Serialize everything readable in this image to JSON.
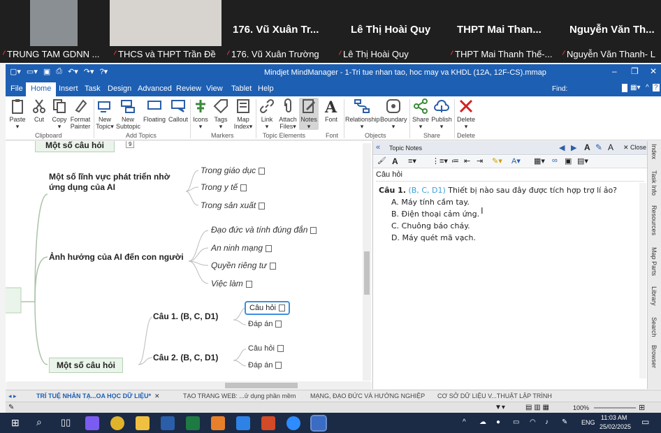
{
  "participants": [
    {
      "tile_name": "",
      "label": "TRUNG TAM GDNN ..."
    },
    {
      "tile_name": "",
      "label": "THCS và THPT Trần Đề"
    },
    {
      "tile_name": "176. Vũ Xuân Tr...",
      "label": "176. Vũ Xuân Trường"
    },
    {
      "tile_name": "Lê Thị Hoài Quy",
      "label": "Lê Thị Hoài Quy"
    },
    {
      "tile_name": "THPT Mai Than...",
      "label": "THPT Mai Thanh Thế-..."
    },
    {
      "tile_name": "Nguyễn Văn Th...",
      "label": "Nguyễn Văn Thanh- L"
    }
  ],
  "window": {
    "title": "Mindjet MindManager - 1-Tri tue nhan tao, hoc may va KHDL (12A, 12F-CS).mmap"
  },
  "menu": {
    "items": [
      "File",
      "Home",
      "Insert",
      "Task",
      "Design",
      "Advanced",
      "Review",
      "View",
      "Tablet",
      "Help"
    ],
    "active": "Home",
    "find_label": "Find:"
  },
  "ribbon": {
    "buttons": [
      {
        "label": "Paste",
        "sub": "▾"
      },
      {
        "label": "Cut",
        "sub": ""
      },
      {
        "label": "Copy",
        "sub": "▾"
      },
      {
        "label": "Format",
        "sub": "Painter"
      },
      {
        "label": "New",
        "sub": "Topic▾"
      },
      {
        "label": "New",
        "sub": "Subtopic"
      },
      {
        "label": "Floating",
        "sub": ""
      },
      {
        "label": "Callout",
        "sub": ""
      },
      {
        "label": "Icons",
        "sub": "▾"
      },
      {
        "label": "Tags",
        "sub": "▾"
      },
      {
        "label": "Map",
        "sub": "Index▾"
      },
      {
        "label": "Link",
        "sub": "▾"
      },
      {
        "label": "Attach",
        "sub": "Files▾"
      },
      {
        "label": "Notes",
        "sub": "▾"
      },
      {
        "label": "Font",
        "sub": ""
      },
      {
        "label": "Relationship",
        "sub": "▾"
      },
      {
        "label": "Boundary",
        "sub": "▾"
      },
      {
        "label": "Share",
        "sub": "▾"
      },
      {
        "label": "Publish",
        "sub": "▾"
      },
      {
        "label": "Delete",
        "sub": "▾"
      }
    ],
    "groups": [
      "Clipboard",
      "Add Topics",
      "Markers",
      "Topic Elements",
      "Font",
      "Objects",
      "Share",
      "Delete"
    ]
  },
  "map": {
    "top_partial": "Một số câu hỏi",
    "top_badge": "9",
    "branch1": {
      "label_line1": "Một số lĩnh vực phát triển nhờ",
      "label_line2": "ứng dụng của AI",
      "subs": [
        "Trong giáo dục",
        "Trong y tế",
        "Trong sản xuất"
      ]
    },
    "branch2": {
      "label": "Ảnh hưởng của AI đến con người",
      "subs": [
        "Đạo đức và tính đúng đắn",
        "An ninh mạng",
        "Quyền riêng tư",
        "Việc làm"
      ]
    },
    "branch3": {
      "label": "Một số câu hỏi",
      "q1": "Câu 1. (B, C, D1)",
      "q1_subs": [
        "Câu hỏi",
        "Đáp án"
      ],
      "q2": "Câu 2. (B, C, D1)",
      "q2_subs": [
        "Câu hỏi",
        "Đáp án"
      ]
    }
  },
  "notes": {
    "header": "Topic Notes",
    "close": "Close",
    "topic": "Câu hỏi",
    "q_label": "Câu 1.",
    "q_tag": "(B, C, D1)",
    "q_text": "Thiết bị nào sau đây được tích hợp trợ lí ảo?",
    "answers": [
      "A.  Máy tính cầm tay.",
      "B.  Điện thoại cảm ứng.",
      "C.  Chuông báo cháy.",
      "D.  Máy quét mã vạch."
    ]
  },
  "dock": [
    "Index",
    "Task Info",
    "Resources",
    "Map Parts",
    "Library",
    "Search",
    "Browser"
  ],
  "doctabs": [
    "TRÍ TUỆ NHÂN TẠ...OA HỌC DỮ LIỆU*",
    "TẠO TRANG WEB: ...ử dụng phần mềm",
    "MẠNG, ĐẠO ĐỨC VÀ HƯỚNG NGHIỆP",
    "CƠ SỞ DỮ LIỆU V...THUẬT LẬP TRÌNH"
  ],
  "status": {
    "zoom": "100%"
  },
  "taskbar": {
    "lang": "ENG",
    "time": "11:03 AM",
    "date": "25/02/2025"
  }
}
